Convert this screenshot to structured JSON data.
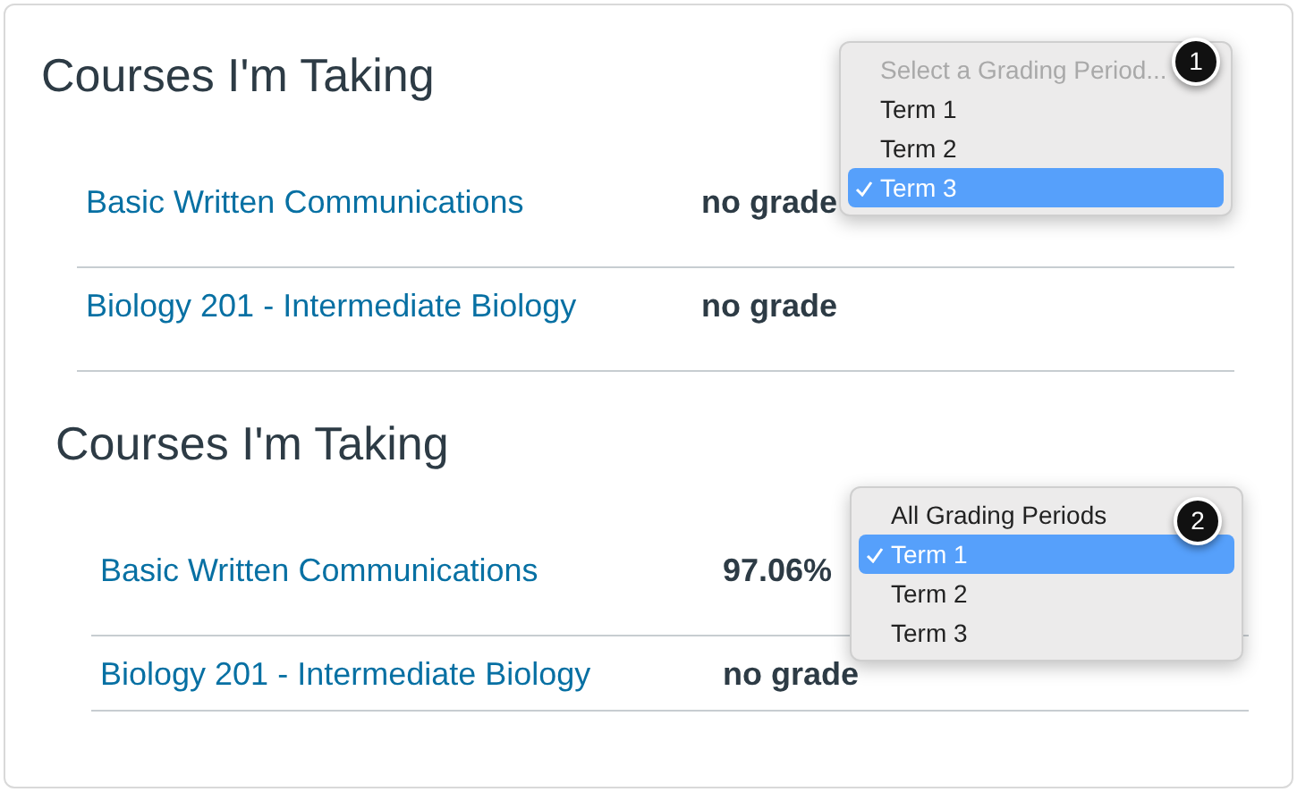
{
  "sections": [
    {
      "title": "Courses I'm Taking",
      "courses": [
        {
          "name": "Basic Written Communications",
          "grade": "no grade"
        },
        {
          "name": "Biology 201 - Intermediate Biology",
          "grade": "no grade"
        }
      ],
      "menu": {
        "badge": "1",
        "items": [
          {
            "label": "Select a Grading Period...",
            "selected": false,
            "disabled": true
          },
          {
            "label": "Term 1",
            "selected": false,
            "disabled": false
          },
          {
            "label": "Term 2",
            "selected": false,
            "disabled": false
          },
          {
            "label": "Term 3",
            "selected": true,
            "disabled": false
          }
        ]
      }
    },
    {
      "title": "Courses I'm Taking",
      "courses": [
        {
          "name": "Basic Written Communications",
          "grade": "97.06%"
        },
        {
          "name": "Biology 201 - Intermediate Biology",
          "grade": "no grade"
        }
      ],
      "menu": {
        "badge": "2",
        "items": [
          {
            "label": "All Grading Periods",
            "selected": false,
            "disabled": false
          },
          {
            "label": "Term 1",
            "selected": true,
            "disabled": false
          },
          {
            "label": "Term 2",
            "selected": false,
            "disabled": false
          },
          {
            "label": "Term 3",
            "selected": false,
            "disabled": false
          }
        ]
      }
    }
  ]
}
